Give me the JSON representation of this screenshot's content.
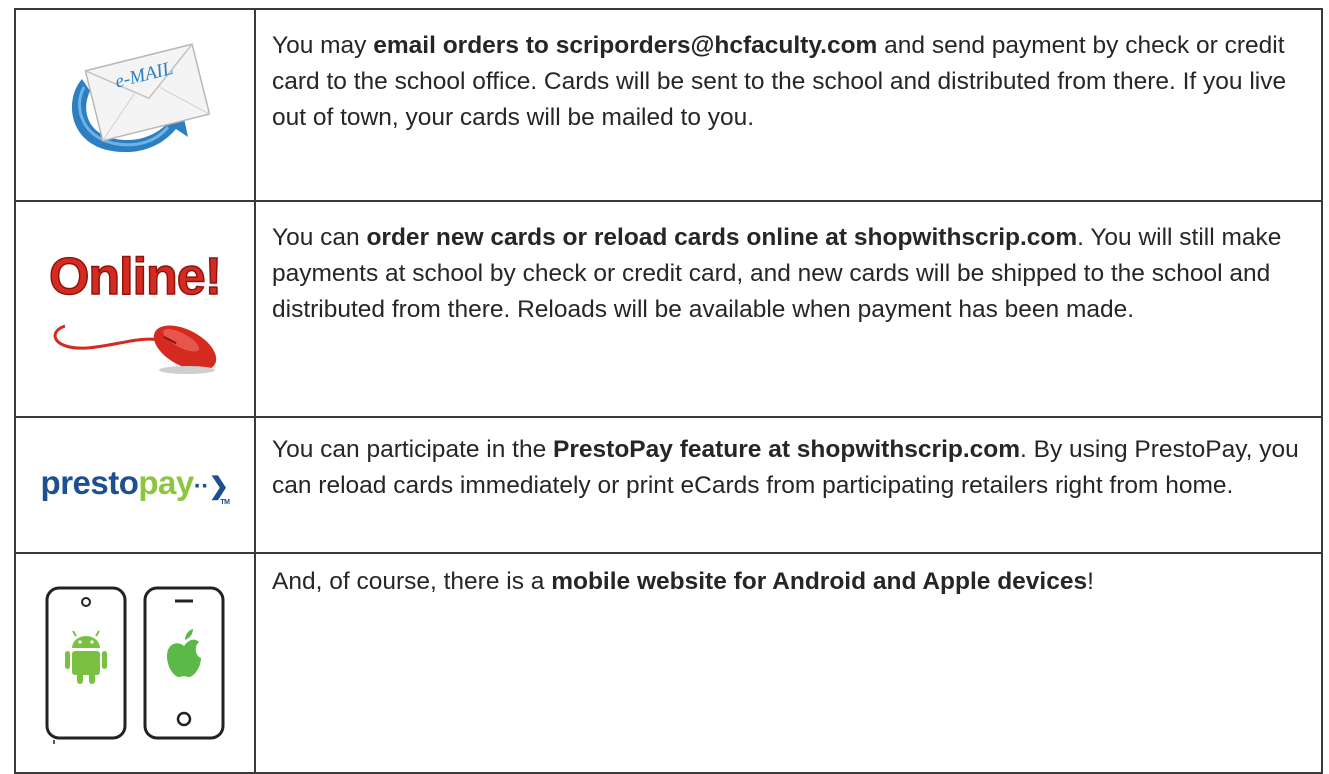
{
  "rows": [
    {
      "icon": "email-envelope-icon",
      "icon_text": "e-MAIL",
      "segments": [
        {
          "text": "You may ",
          "bold": false
        },
        {
          "text": "email orders to scriporders@hcfaculty.com",
          "bold": true
        },
        {
          "text": " and send payment by check or credit card to the school office. Cards will be sent to the school and distributed from there. If you live out of town, your cards will be mailed to you.",
          "bold": false
        }
      ]
    },
    {
      "icon": "online-mouse-icon",
      "icon_text": "Online!",
      "segments": [
        {
          "text": "You can ",
          "bold": false
        },
        {
          "text": "order new cards or reload cards online at shopwithscrip.com",
          "bold": true
        },
        {
          "text": ". You will still make payments at school by check or credit card, and new cards will be shipped to the school and distributed from there. Reloads will be available when payment has been made.",
          "bold": false
        }
      ]
    },
    {
      "icon": "prestopay-logo",
      "icon_text_a": "presto",
      "icon_text_b": "pay",
      "icon_text_tm": "TM",
      "segments": [
        {
          "text": "You can participate in the ",
          "bold": false
        },
        {
          "text": "PrestoPay feature at shopwithscrip.com",
          "bold": true
        },
        {
          "text": ". By using PrestoPay, you can reload cards immediately or print eCards from participating retailers right from home.",
          "bold": false
        }
      ]
    },
    {
      "icon": "mobile-phones-icon",
      "segments": [
        {
          "text": "And, of course, there is a ",
          "bold": false
        },
        {
          "text": "mobile website for Android and Apple devices",
          "bold": true
        },
        {
          "text": "!",
          "bold": false
        }
      ]
    }
  ],
  "colors": {
    "email_blue": "#2d7fc1",
    "online_red": "#d42a20",
    "presto_blue": "#1d4f91",
    "presto_green": "#8cc63f",
    "android_green": "#7ac142",
    "apple_green": "#5bb948"
  }
}
